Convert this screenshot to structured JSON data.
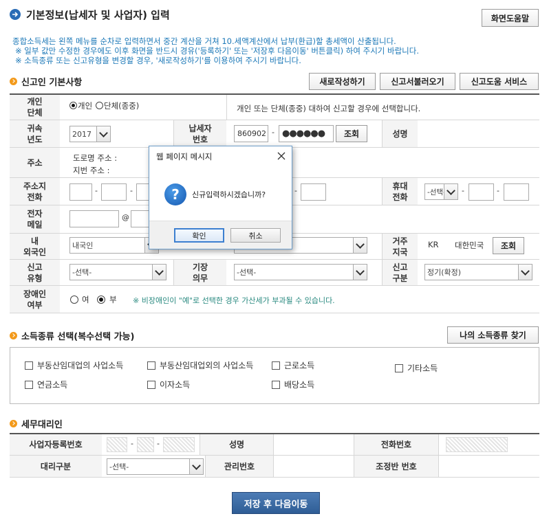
{
  "header": {
    "title": "기본정보(납세자 및 사업자) 입력",
    "help_button": "화면도움말"
  },
  "intro": {
    "line1": "종합소득세는 왼쪽 메뉴를 순차로 입력하면서 중간 계산을 거쳐 10.세액계산에서 납부(환급)할 총세액이 산출됩니다.",
    "line2": "※ 일부 값만 수정한 경우에도 이후 화면을 반드시 경유('등록하기' 또는 '저장후 다음이동' 버튼클릭) 하여 주시기 바랍니다.",
    "line3": "※ 소득종류 또는 신고유형을 변경할 경우, '새로작성하기'를 이용하여 주시기 바랍니다."
  },
  "section1": {
    "title": "신고인 기본사항",
    "btn_new": "새로작성하기",
    "btn_load": "신고서불러오기",
    "btn_service": "신고도움 서비스"
  },
  "form": {
    "type_label": "개인\n단체",
    "type_opt1": "개인",
    "type_opt2": "단체(종중)",
    "type_desc": "개인 또는 단체(종중) 대하여 신고할 경우에 선택합니다.",
    "year_label": "귀속\n년도",
    "year_value": "2017",
    "taxid_label": "납세자\n번호",
    "taxid_front": "860902",
    "taxid_back": "●●●●●●",
    "taxid_btn": "조회",
    "name_label": "성명",
    "addr_label": "주소",
    "addr_road": "도로명 주소 :",
    "addr_lot": "지번 주소 :",
    "phone_label": "주소지\n전화",
    "mobile_label": "휴대\n전화",
    "mobile_select": "-선택-",
    "email_label": "전자\n메일",
    "at": "@",
    "foreign_label": "내\n외국인",
    "foreign_value": "내국인",
    "country_label": "거주\n지국",
    "country_code": "KR",
    "country_name": "대한민국",
    "country_btn": "조회",
    "filetype_label": "신고\n유형",
    "filetype_value": "-선택-",
    "bookkeep_label": "기장\n의무",
    "bookkeep_value": "-선택-",
    "filecat_label": "신고\n구분",
    "filecat_value": "정기(확정)",
    "disabled_label": "장애인\n여부",
    "disabled_yes": "여",
    "disabled_no": "부",
    "disabled_note": "※ 비장애인이 \"예\"로 선택한 경우 가산세가 부과될 수 있습니다."
  },
  "section2": {
    "title": "소득종류 선택(복수선택 가능)",
    "find_btn": "나의 소득종류 찾기",
    "items": [
      "부동산임대업의 사업소득",
      "부동산임대업외의 사업소득",
      "근로소득",
      "기타소득",
      "연금소득",
      "이자소득",
      "배당소득"
    ]
  },
  "section3": {
    "title": "세무대리인",
    "bizno_label": "사업자등록번호",
    "name_label": "성명",
    "phone_label": "전화번호",
    "agent_type_label": "대리구분",
    "agent_type_value": "-선택-",
    "mgmt_label": "관리번호",
    "adj_label": "조정반 번호"
  },
  "save_button": "저장 후 다음이동",
  "dialog": {
    "title": "웹 페이지 메시지",
    "message": "신규입력하시겠습니까?",
    "ok": "확인",
    "cancel": "취소"
  },
  "colors": {
    "accent": "#2f5d95",
    "orange": "#f39a1b",
    "note": "#1a77b7",
    "teal": "#2a8a80"
  }
}
